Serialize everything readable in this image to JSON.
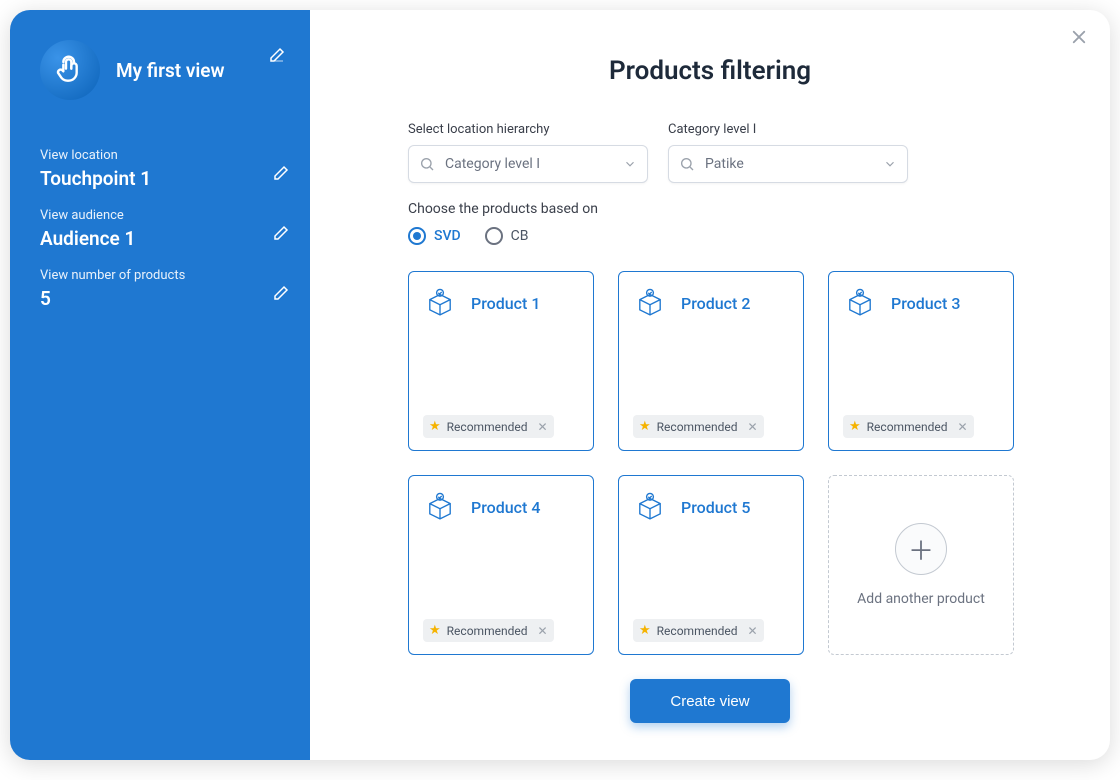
{
  "sidebar": {
    "title": "My first view",
    "groups": [
      {
        "label": "View  location",
        "value": "Touchpoint 1"
      },
      {
        "label": "View  audience",
        "value": "Audience 1"
      },
      {
        "label": "View  number of products",
        "value": "5"
      }
    ]
  },
  "main": {
    "title": "Products filtering",
    "filters": {
      "location_label": "Select location hierarchy",
      "location_value": "Category level I",
      "category_label": "Category level I",
      "category_value": "Patike"
    },
    "choose_label": "Choose the products based on",
    "radios": {
      "opt1": "SVD",
      "opt2": "CB"
    },
    "products": [
      {
        "name": "Product 1",
        "tag": "Recommended"
      },
      {
        "name": "Product 2",
        "tag": "Recommended"
      },
      {
        "name": "Product 3",
        "tag": "Recommended"
      },
      {
        "name": "Product 4",
        "tag": "Recommended"
      },
      {
        "name": "Product 5",
        "tag": "Recommended"
      }
    ],
    "add_label": "Add another product",
    "cta": "Create view"
  }
}
